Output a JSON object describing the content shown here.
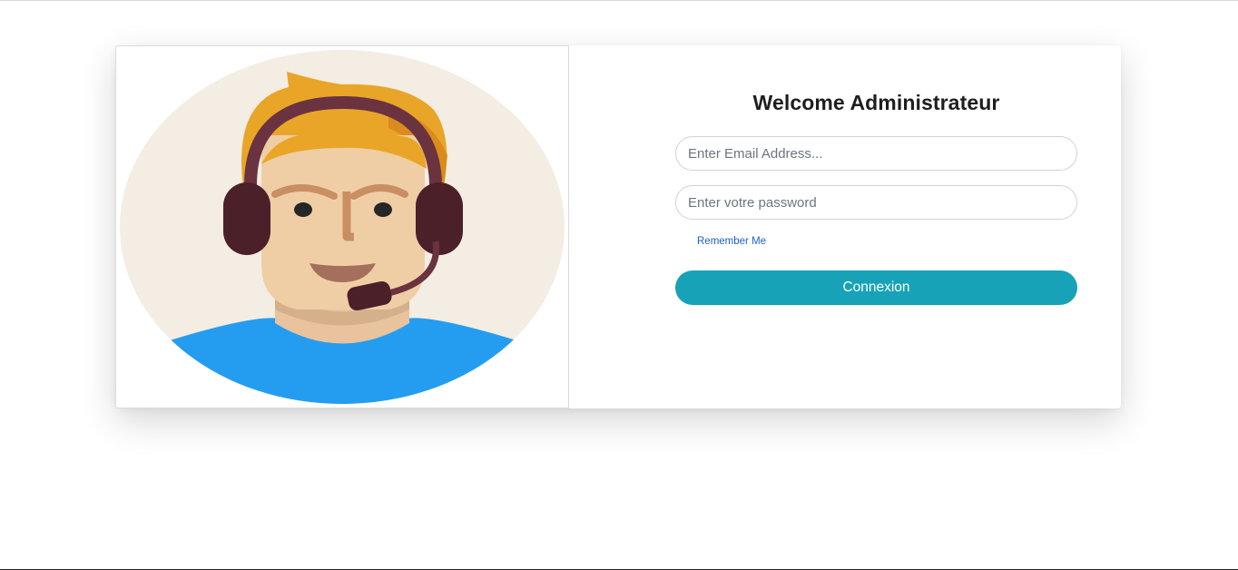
{
  "colors": {
    "accent": "#17a2b8",
    "link": "#1a62c9",
    "avatar_background": "#f4ede3",
    "avatar_shirt": "#249df1",
    "avatar_hair": "#e9a528",
    "avatar_skin": "#f0cea5",
    "avatar_headset": "#6b3340"
  },
  "avatar": {
    "icon": "support-agent-headset-icon"
  },
  "login": {
    "title": "Welcome Administrateur",
    "email_placeholder": "Enter Email Address...",
    "email_value": "",
    "password_placeholder": "Enter votre password",
    "password_value": "",
    "remember_label": "Remember Me",
    "submit_label": "Connexion"
  }
}
